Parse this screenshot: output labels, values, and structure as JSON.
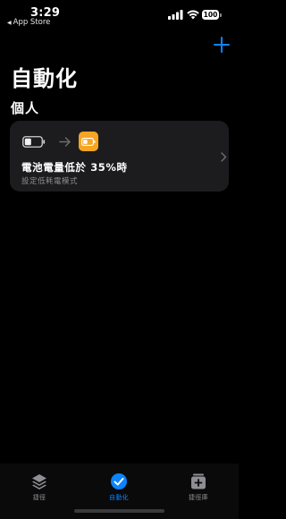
{
  "status_bar": {
    "time": "3:29",
    "back_app": "App Store",
    "battery": "100"
  },
  "header": {
    "title": "自動化",
    "add_icon": "plus-icon"
  },
  "section": {
    "title": "個人"
  },
  "automation_card": {
    "trigger": "電池電量低於 35%時",
    "action": "設定低耗電模式",
    "icons": [
      "battery-icon",
      "arrow-icon",
      "low-power-battery-icon",
      "chevron-right-icon"
    ]
  },
  "tabbar": {
    "tabs": [
      {
        "label": "捷徑",
        "icon": "layers-icon",
        "active": false
      },
      {
        "label": "自動化",
        "icon": "clock-check-icon",
        "active": true
      },
      {
        "label": "捷徑庫",
        "icon": "gallery-plus-icon",
        "active": false
      }
    ]
  },
  "colors": {
    "accent": "#0a84ff",
    "card_bg": "#1c1c1e",
    "app_icon": "#f5a524",
    "secondary_text": "#8e8e93"
  }
}
